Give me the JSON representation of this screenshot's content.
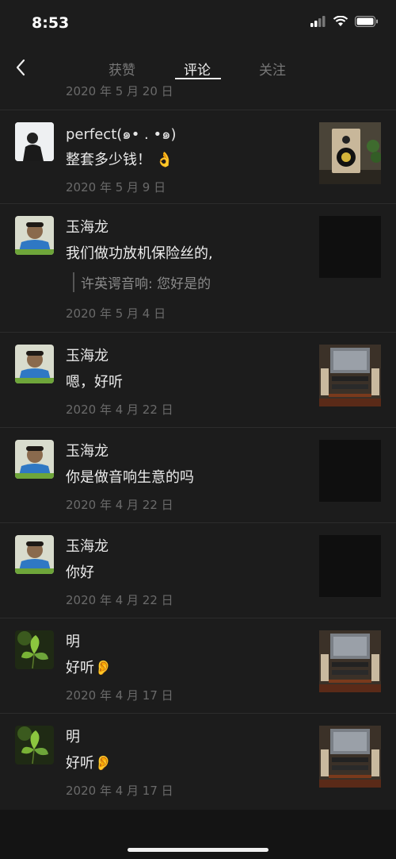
{
  "status": {
    "time": "8:53"
  },
  "tabs": [
    {
      "label": "获赞"
    },
    {
      "label": "评论"
    },
    {
      "label": "关注"
    }
  ],
  "list": {
    "cut_date": "2020 年 5 月 20 日",
    "items": [
      {
        "name": "perfect(๑• . •๑)",
        "comment": "整套多少钱！",
        "comment_emoji": "👌",
        "date": "2020 年 5 月 9 日"
      },
      {
        "name": "玉海龙",
        "comment": "我们做功放机保险丝的,",
        "reply": "许英谔音响: 您好是的",
        "date": "2020 年 5 月 4 日"
      },
      {
        "name": "玉海龙",
        "comment": "嗯，好听",
        "date": "2020 年 4 月 22 日"
      },
      {
        "name": "玉海龙",
        "comment": "你是做音响生意的吗",
        "date": "2020 年 4 月 22 日"
      },
      {
        "name": "玉海龙",
        "comment": "你好",
        "date": "2020 年 4 月 22 日"
      },
      {
        "name": "明",
        "comment": "好听",
        "comment_emoji": "👂",
        "date": "2020 年 4 月 17 日"
      },
      {
        "name": "明",
        "comment": "好听",
        "comment_emoji": "👂",
        "date": "2020 年 4 月 17 日"
      }
    ]
  }
}
